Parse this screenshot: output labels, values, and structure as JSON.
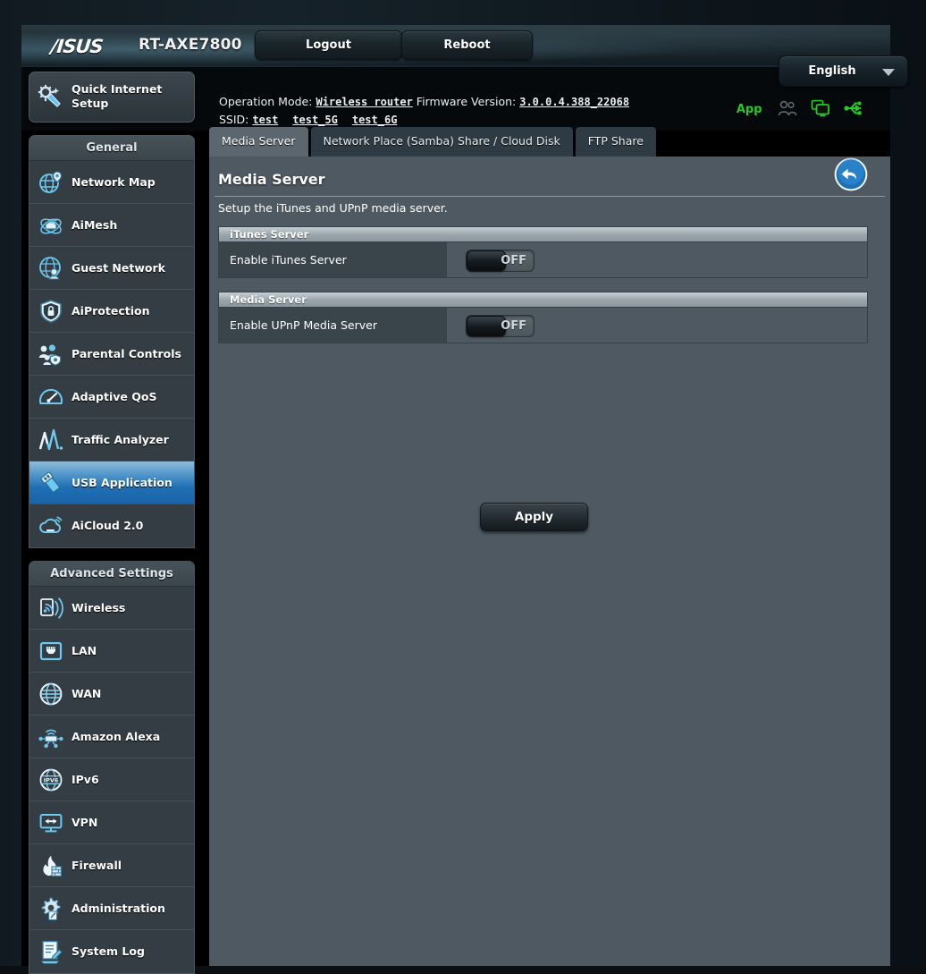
{
  "header": {
    "brand": "/ISUS",
    "model": "RT-AXE7800",
    "logout_label": "Logout",
    "reboot_label": "Reboot",
    "language": "English",
    "operation_mode_label": "Operation Mode:",
    "operation_mode_value": "Wireless router",
    "firmware_label": "Firmware Version:",
    "firmware_value": "3.0.0.4.388_22068",
    "ssid_label": "SSID:",
    "ssid_values": [
      "test",
      "test_5G",
      "test_6G"
    ],
    "app_label": "App",
    "status_icons": [
      "users-icon",
      "network-clients-icon",
      "usb-icon"
    ]
  },
  "sidebar": {
    "quick_setup": {
      "label": "Quick Internet Setup",
      "icon": "quick-setup-icon"
    },
    "groups": [
      {
        "title": "General",
        "items": [
          {
            "label": "Network Map",
            "icon": "network-map-icon",
            "active": false
          },
          {
            "label": "AiMesh",
            "icon": "aimesh-icon",
            "active": false
          },
          {
            "label": "Guest Network",
            "icon": "guest-network-icon",
            "active": false
          },
          {
            "label": "AiProtection",
            "icon": "aiprotection-icon",
            "active": false
          },
          {
            "label": "Parental Controls",
            "icon": "parental-controls-icon",
            "active": false
          },
          {
            "label": "Adaptive QoS",
            "icon": "adaptive-qos-icon",
            "active": false
          },
          {
            "label": "Traffic Analyzer",
            "icon": "traffic-analyzer-icon",
            "active": false
          },
          {
            "label": "USB Application",
            "icon": "usb-application-icon",
            "active": true
          },
          {
            "label": "AiCloud 2.0",
            "icon": "aicloud-icon",
            "active": false
          }
        ]
      },
      {
        "title": "Advanced Settings",
        "items": [
          {
            "label": "Wireless",
            "icon": "wireless-icon",
            "active": false
          },
          {
            "label": "LAN",
            "icon": "lan-icon",
            "active": false
          },
          {
            "label": "WAN",
            "icon": "wan-icon",
            "active": false
          },
          {
            "label": "Amazon Alexa",
            "icon": "amazon-alexa-icon",
            "active": false
          },
          {
            "label": "IPv6",
            "icon": "ipv6-icon",
            "active": false
          },
          {
            "label": "VPN",
            "icon": "vpn-icon",
            "active": false
          },
          {
            "label": "Firewall",
            "icon": "firewall-icon",
            "active": false
          },
          {
            "label": "Administration",
            "icon": "administration-icon",
            "active": false
          },
          {
            "label": "System Log",
            "icon": "system-log-icon",
            "active": false
          }
        ]
      }
    ]
  },
  "main": {
    "tabs": [
      {
        "label": "Media Server",
        "active": true
      },
      {
        "label": "Network Place (Samba) Share / Cloud Disk",
        "active": false
      },
      {
        "label": "FTP Share",
        "active": false
      }
    ],
    "page_title": "Media Server",
    "description": "Setup the iTunes and UPnP media server.",
    "back_icon": "back-arrow-icon",
    "sections": [
      {
        "title": "iTunes Server",
        "rows": [
          {
            "label": "Enable iTunes Server",
            "control": "toggle",
            "state": "OFF"
          }
        ]
      },
      {
        "title": "Media Server",
        "rows": [
          {
            "label": "Enable UPnP Media Server",
            "control": "toggle",
            "state": "OFF"
          }
        ]
      }
    ],
    "apply_label": "Apply"
  },
  "colors": {
    "panel_bg": "#4e5961",
    "sidebar_bg": "#333d43",
    "active_nav": "#1f6fb5",
    "accent_green": "#22cc22",
    "icon_blue": "#62c4ef"
  }
}
